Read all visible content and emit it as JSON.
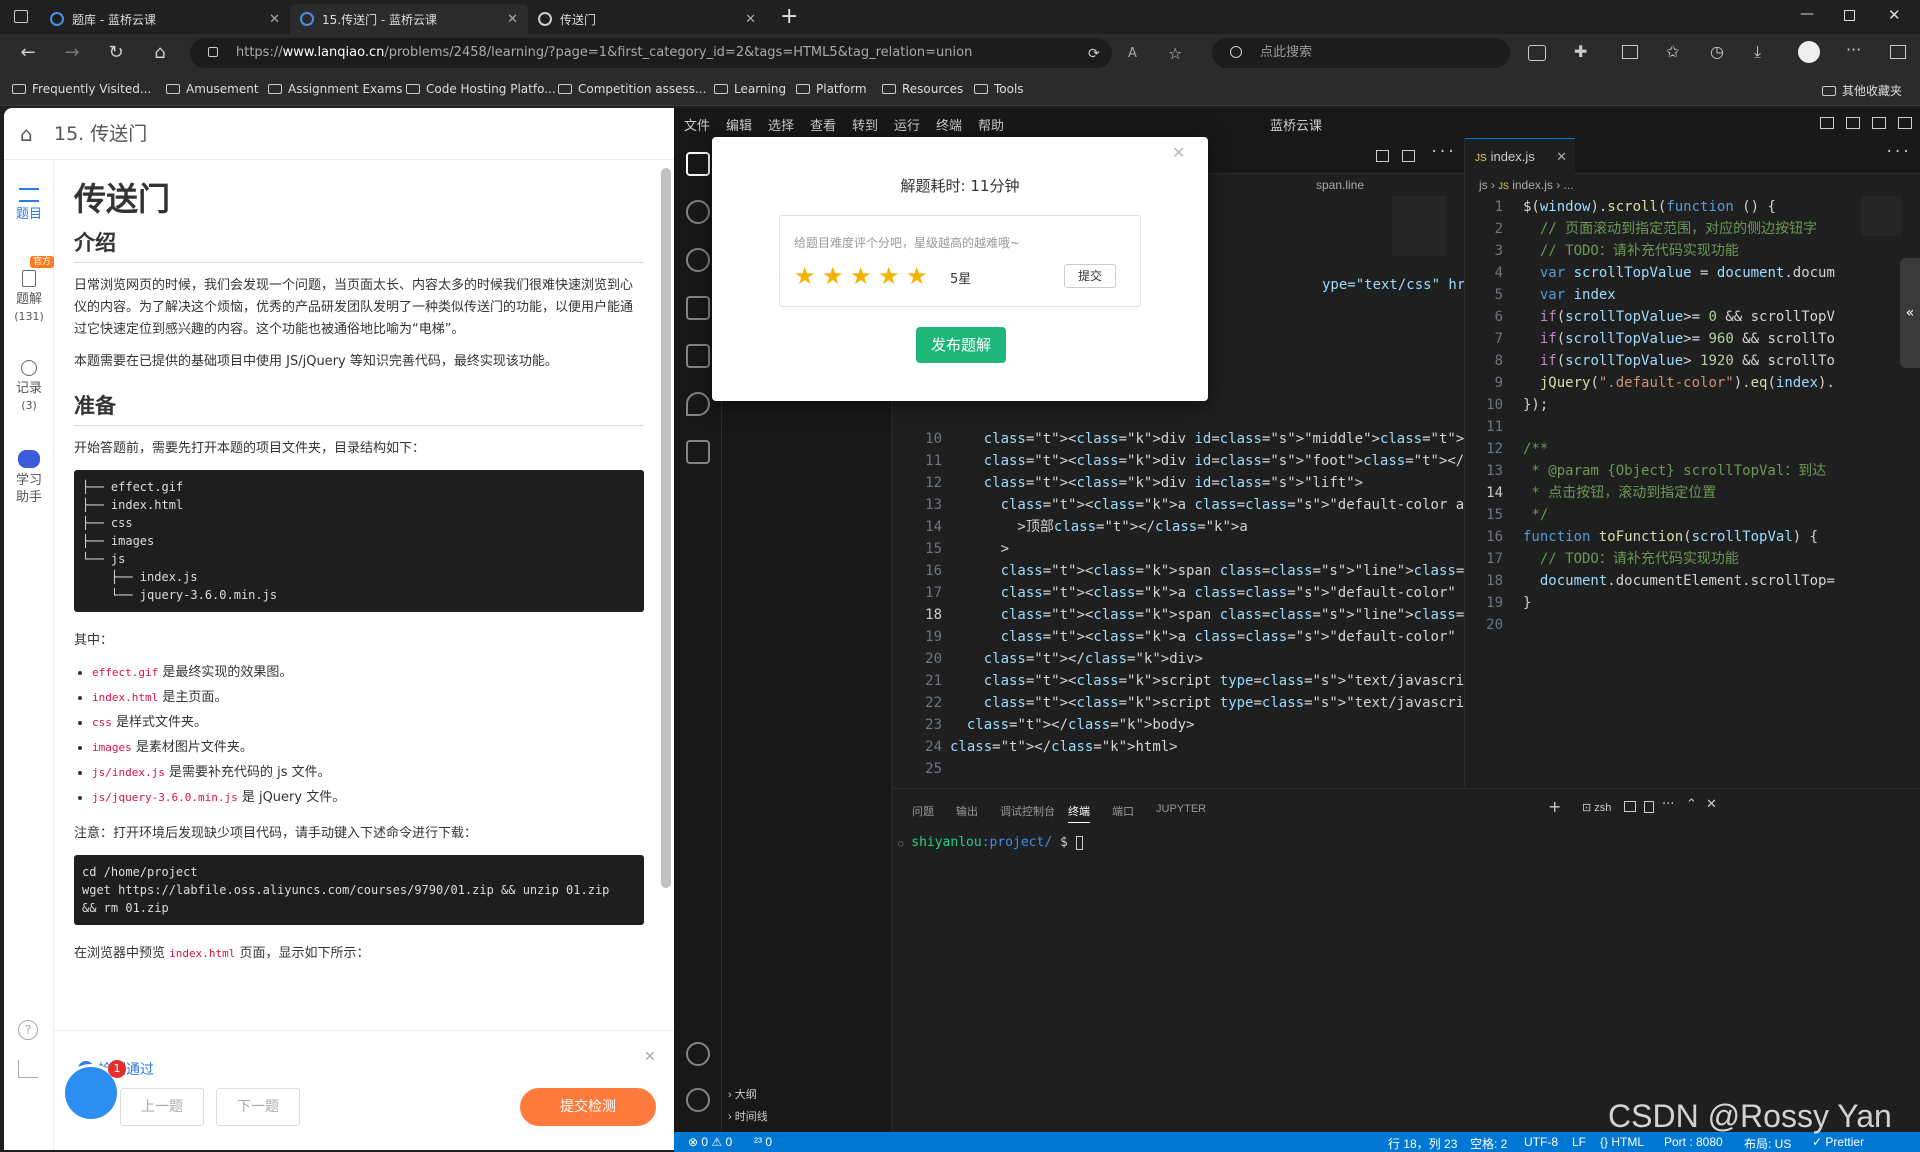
{
  "browser": {
    "tabs": [
      {
        "label": "题库 - 蓝桥云课"
      },
      {
        "label": "15.传送门 - 蓝桥云课"
      },
      {
        "label": "传送门"
      }
    ],
    "url_prefix": "https://",
    "url_host": "www.lanqiao.cn",
    "url_path": "/problems/2458/learning/?page=1&first_category_id=2&tags=HTML5&tag_relation=union",
    "search_placeholder": "点此搜索",
    "bookmarks": [
      "Frequently Visited...",
      "Amusement",
      "Assignment Exams",
      "Code Hosting Platfo...",
      "Competition assess...",
      "Learning",
      "Platform",
      "Resources",
      "Tools"
    ],
    "other_bookmarks": "其他收藏夹"
  },
  "problem": {
    "header_title": "15. 传送门",
    "rail": {
      "questions": "题目",
      "solutions": "题解",
      "solutions_count": "(131)",
      "official_badge": "官方",
      "records": "记录",
      "records_count": "(3)",
      "assistant_1": "学习",
      "assistant_2": "助手"
    },
    "title": "传送门",
    "intro_heading": "介绍",
    "intro_p1": "日常浏览网页的时候，我们会发现一个问题，当页面太长、内容太多的时候我们很难快速浏览到心仪的内容。为了解决这个烦恼，优秀的产品研发团队发明了一种类似传送门的功能，以便用户能通过它快速定位到感兴趣的内容。这个功能也被通俗地比喻为“电梯”。",
    "intro_p2": "本题需要在已提供的基础项目中使用 JS/jQuery 等知识完善代码，最终实现该功能。",
    "prep_heading": "准备",
    "prep_p1": "开始答题前，需要先打开本题的项目文件夹，目录结构如下：",
    "tree": "├── effect.gif\n├── index.html\n├── css\n├── images\n└── js\n    ├── index.js\n    └── jquery-3.6.0.min.js",
    "among": "其中：",
    "items": [
      {
        "code": "effect.gif",
        "text": " 是最终实现的效果图。"
      },
      {
        "code": "index.html",
        "text": " 是主页面。"
      },
      {
        "code": "css",
        "text": " 是样式文件夹。"
      },
      {
        "code": "images",
        "text": " 是素材图片文件夹。"
      },
      {
        "code": "js/index.js",
        "text": " 是需要补充代码的 js 文件。"
      },
      {
        "code": "js/jquery-3.6.0.min.js",
        "text": " 是 jQuery 文件。"
      }
    ],
    "note": "注意：打开环境后发现缺少项目代码，请手动键入下述命令进行下载：",
    "cmd": "cd /home/project\nwget https://labfile.oss.aliyuncs.com/courses/9790/01.zip && unzip 01.zip\n&& rm 01.zip",
    "preview_pre": "在浏览器中预览 ",
    "preview_code": "index.html",
    "preview_post": " 页面，显示如下所示：",
    "check_passed": "检测通过",
    "prev": "上一题",
    "next": "下一题",
    "submit_check": "提交检测",
    "notif_count": "1"
  },
  "vscode": {
    "menu": [
      "文件",
      "编辑",
      "选择",
      "查看",
      "转到",
      "运行",
      "终端",
      "帮助"
    ],
    "window_title": "蓝桥云课",
    "left_crumb": "span.line",
    "right_tab": "index.js",
    "right_crumb_1": "js",
    "right_crumb_2": "index.js",
    "right_crumb_3": "...",
    "left_lines": [
      {
        "n": "10",
        "code": "    <div id=\"middle\"></div>"
      },
      {
        "n": "11",
        "code": "    <div id=\"foot\"></div>"
      },
      {
        "n": "12",
        "code": "    <div id=\"lift\">"
      },
      {
        "n": "13",
        "code": "      <a class=\"default-color active-color\" oncl"
      },
      {
        "n": "14",
        "code": "        >顶部</a"
      },
      {
        "n": "15",
        "code": "      >"
      },
      {
        "n": "16",
        "code": "      <span class=\"line\"></span>"
      },
      {
        "n": "17",
        "code": "      <a class=\"default-color\" onclick=\"toFuncti"
      },
      {
        "n": "18",
        "code": "      <span class=\"line\"></span>"
      },
      {
        "n": "19",
        "code": "      <a class=\"default-color\" onclick=\"toFuncti"
      },
      {
        "n": "20",
        "code": "    </div>"
      },
      {
        "n": "21",
        "code": "    <script type=\"text/javascript\" src=\"./js/jqu"
      },
      {
        "n": "22",
        "code": "    <script type=\"text/javascript\" src=\"./js/ind"
      },
      {
        "n": "23",
        "code": "  </body>"
      },
      {
        "n": "24",
        "code": "</html>"
      },
      {
        "n": "25",
        "code": ""
      }
    ],
    "left_partial_line": "ype=\"text/css\" href=",
    "right_lines": [
      {
        "n": "1",
        "code": "$(window).scroll(function () {"
      },
      {
        "n": "2",
        "code": "  // 页面滚动到指定范围，对应的侧边按钮字"
      },
      {
        "n": "3",
        "code": "  // TODO：请补充代码实现功能"
      },
      {
        "n": "4",
        "code": "  var scrollTopValue = document.docum"
      },
      {
        "n": "5",
        "code": "  var index"
      },
      {
        "n": "6",
        "code": "  if(scrollTopValue>= 0 && scrollTopV"
      },
      {
        "n": "7",
        "code": "  if(scrollTopValue>= 960 && scrollTo"
      },
      {
        "n": "8",
        "code": "  if(scrollTopValue> 1920 && scrollTo"
      },
      {
        "n": "9",
        "code": "  jQuery(\".default-color\").eq(index)."
      },
      {
        "n": "10",
        "code": "});"
      },
      {
        "n": "11",
        "code": ""
      },
      {
        "n": "12",
        "code": "/**"
      },
      {
        "n": "13",
        "code": " * @param {Object} scrollTopVal：到达"
      },
      {
        "n": "14",
        "code": " * 点击按钮，滚动到指定位置"
      },
      {
        "n": "15",
        "code": " */"
      },
      {
        "n": "16",
        "code": "function toFunction(scrollTopVal) {"
      },
      {
        "n": "17",
        "code": "  // TODO：请补充代码实现功能"
      },
      {
        "n": "18",
        "code": "  document.documentElement.scrollTop="
      },
      {
        "n": "19",
        "code": "}"
      },
      {
        "n": "20",
        "code": ""
      }
    ],
    "panel_tabs": [
      "问题",
      "输出",
      "调试控制台",
      "终端",
      "端口",
      "JUPYTER"
    ],
    "terminal_shell": "zsh",
    "terminal_user": "shiyanlou",
    "terminal_path": ":project/",
    "terminal_prompt": " $ ",
    "outline": "大纲",
    "timeline": "时间线",
    "status": {
      "errors": "⊗ 0 ⚠ 0",
      "ports": "²³ 0",
      "position": "行 18，列 23",
      "spaces": "空格: 2",
      "encoding": "UTF-8",
      "eol": "LF",
      "lang": "{} HTML",
      "port": "Port : 8080",
      "layout": "布局: US",
      "prettier": "✓ Prettier"
    }
  },
  "modal": {
    "title": "解题耗时: 11分钟",
    "placeholder": "给题目难度评个分吧，星级越高的越难哦~",
    "stars": 5,
    "stars_label": "5星",
    "submit": "提交",
    "publish": "发布题解"
  },
  "watermark": "CSDN @Rossy Yan"
}
